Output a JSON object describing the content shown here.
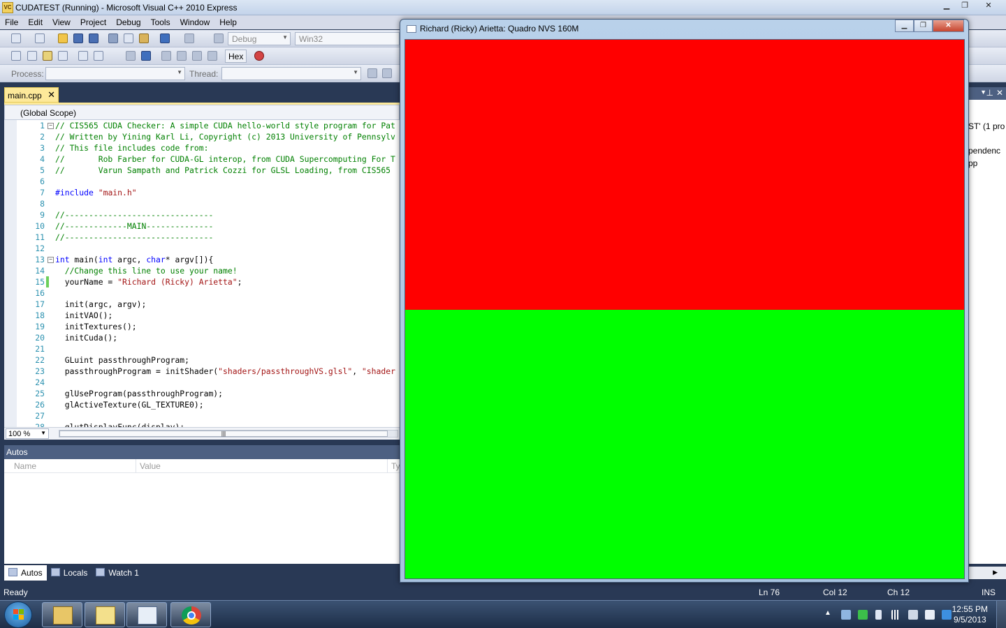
{
  "vs": {
    "title": "CUDATEST (Running) - Microsoft Visual C++ 2010 Express",
    "app_icon": "VC",
    "menu": [
      "File",
      "Edit",
      "View",
      "Project",
      "Debug",
      "Tools",
      "Window",
      "Help"
    ],
    "toolbar": {
      "config": "Debug",
      "platform": "Win32",
      "hex_label": "Hex",
      "process_label": "Process:",
      "thread_label": "Thread:"
    },
    "doc_tab": "main.cpp",
    "scope": "(Global Scope)",
    "zoom": "100 %",
    "status": {
      "ready": "Ready",
      "ln": "Ln 76",
      "col": "Col 12",
      "ch": "Ch 12",
      "ins": "INS"
    },
    "autos": {
      "title": "Autos",
      "columns": [
        "Name",
        "Value",
        "Ty"
      ],
      "tabs": [
        "Autos",
        "Locals",
        "Watch 1"
      ]
    },
    "right_dock": {
      "lines": [
        "ST' (1 pro",
        "pendenc",
        "pp"
      ]
    }
  },
  "code": [
    {
      "n": "1",
      "fold": "⊟",
      "parts": [
        {
          "c": "cmt",
          "t": "// CIS565 CUDA Checker: A simple CUDA hello-world style program for Pat"
        }
      ]
    },
    {
      "n": "2",
      "parts": [
        {
          "c": "cmt",
          "t": "// Written by Yining Karl Li, Copyright (c) 2013 University of Pennsylv"
        }
      ]
    },
    {
      "n": "3",
      "parts": [
        {
          "c": "cmt",
          "t": "// This file includes code from:"
        }
      ]
    },
    {
      "n": "4",
      "parts": [
        {
          "c": "cmt",
          "t": "//       Rob Farber for CUDA-GL interop, from CUDA Supercomputing For T"
        }
      ]
    },
    {
      "n": "5",
      "parts": [
        {
          "c": "cmt",
          "t": "//       Varun Sampath and Patrick Cozzi for GLSL Loading, from CIS565"
        }
      ]
    },
    {
      "n": "6",
      "parts": []
    },
    {
      "n": "7",
      "parts": [
        {
          "c": "kw",
          "t": "#include"
        },
        {
          "c": "",
          "t": " "
        },
        {
          "c": "str",
          "t": "\"main.h\""
        }
      ]
    },
    {
      "n": "8",
      "parts": []
    },
    {
      "n": "9",
      "parts": [
        {
          "c": "cmt",
          "t": "//-------------------------------"
        }
      ]
    },
    {
      "n": "10",
      "parts": [
        {
          "c": "cmt",
          "t": "//-------------MAIN--------------"
        }
      ]
    },
    {
      "n": "11",
      "parts": [
        {
          "c": "cmt",
          "t": "//-------------------------------"
        }
      ]
    },
    {
      "n": "12",
      "parts": []
    },
    {
      "n": "13",
      "fold": "⊟",
      "parts": [
        {
          "c": "kw",
          "t": "int"
        },
        {
          "c": "",
          "t": " main("
        },
        {
          "c": "kw",
          "t": "int"
        },
        {
          "c": "",
          "t": " argc, "
        },
        {
          "c": "kw",
          "t": "char"
        },
        {
          "c": "",
          "t": "* argv[]){"
        }
      ]
    },
    {
      "n": "14",
      "parts": [
        {
          "c": "cmt",
          "t": "  //Change this line to use your name!"
        }
      ]
    },
    {
      "n": "15",
      "changed": true,
      "parts": [
        {
          "c": "",
          "t": "  yourName = "
        },
        {
          "c": "str",
          "t": "\"Richard (Ricky) Arietta\""
        },
        {
          "c": "",
          "t": ";"
        }
      ]
    },
    {
      "n": "16",
      "parts": []
    },
    {
      "n": "17",
      "parts": [
        {
          "c": "",
          "t": "  init(argc, argv);"
        }
      ]
    },
    {
      "n": "18",
      "parts": [
        {
          "c": "",
          "t": "  initVAO();"
        }
      ]
    },
    {
      "n": "19",
      "parts": [
        {
          "c": "",
          "t": "  initTextures();"
        }
      ]
    },
    {
      "n": "20",
      "parts": [
        {
          "c": "",
          "t": "  initCuda();"
        }
      ]
    },
    {
      "n": "21",
      "parts": []
    },
    {
      "n": "22",
      "parts": [
        {
          "c": "",
          "t": "  GLuint passthroughProgram;"
        }
      ]
    },
    {
      "n": "23",
      "parts": [
        {
          "c": "",
          "t": "  passthroughProgram = initShader("
        },
        {
          "c": "str",
          "t": "\"shaders/passthroughVS.glsl\""
        },
        {
          "c": "",
          "t": ", "
        },
        {
          "c": "str",
          "t": "\"shader"
        }
      ]
    },
    {
      "n": "24",
      "parts": []
    },
    {
      "n": "25",
      "parts": [
        {
          "c": "",
          "t": "  glUseProgram(passthroughProgram);"
        }
      ]
    },
    {
      "n": "26",
      "parts": [
        {
          "c": "",
          "t": "  glActiveTexture(GL_TEXTURE0);"
        }
      ]
    },
    {
      "n": "27",
      "parts": []
    },
    {
      "n": "28",
      "parts": [
        {
          "c": "",
          "t": "  glutDisplayFunc(display);"
        }
      ]
    }
  ],
  "gl_window": {
    "title": "Richard (Ricky) Arietta: Quadro NVS 160M",
    "top_color": "#ff0000",
    "bottom_color": "#00ff00"
  },
  "taskbar": {
    "apps": [
      "explorer-icon",
      "visual-studio-icon",
      "console-icon",
      "chrome-icon"
    ],
    "time": "12:55 PM",
    "date": "9/5/2013"
  }
}
